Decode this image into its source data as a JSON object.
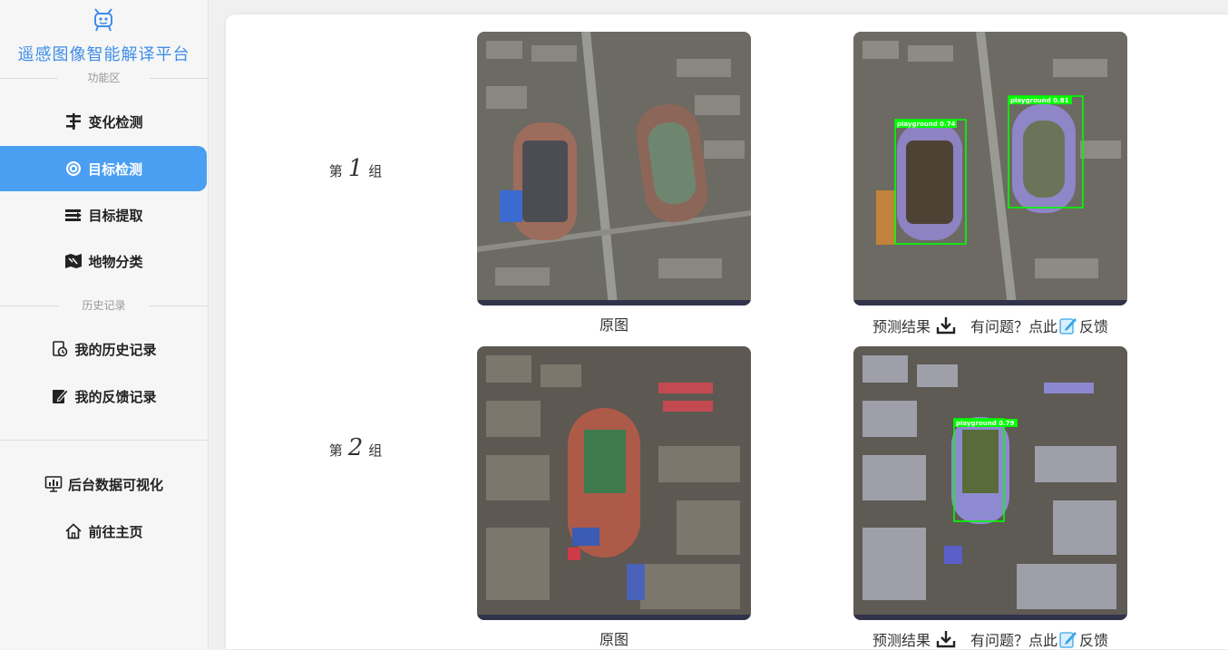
{
  "sidebar": {
    "app_title": "遥感图像智能解译平台",
    "section_functions": "功能区",
    "section_history": "历史记录",
    "items": [
      {
        "label": "变化检测",
        "icon": "change-detect-icon"
      },
      {
        "label": "目标检测",
        "icon": "target-detect-icon",
        "active": true
      },
      {
        "label": "目标提取",
        "icon": "target-extract-icon"
      },
      {
        "label": "地物分类",
        "icon": "land-classify-icon"
      }
    ],
    "history_items": [
      {
        "label": "我的历史记录",
        "icon": "history-icon"
      },
      {
        "label": "我的反馈记录",
        "icon": "feedback-record-icon"
      }
    ],
    "bottom_items": [
      {
        "label": "后台数据可视化",
        "icon": "dashboard-icon"
      },
      {
        "label": "前往主页",
        "icon": "home-icon"
      }
    ]
  },
  "groups": [
    {
      "prefix": "第",
      "number": "1",
      "suffix": "组",
      "original_caption": "原图",
      "result_caption": "预测结果",
      "feedback_prefix": "有问题？点此",
      "feedback_suffix": "反馈",
      "detections": [
        {
          "label": "playground 0.74"
        },
        {
          "label": "playground 0.81"
        }
      ]
    },
    {
      "prefix": "第",
      "number": "2",
      "suffix": "组",
      "original_caption": "原图",
      "result_caption": "预测结果",
      "feedback_prefix": "有问题？点此",
      "feedback_suffix": "反馈",
      "detections": [
        {
          "label": "playground 0.79"
        }
      ]
    }
  ],
  "colors": {
    "accent": "#4b9ff2",
    "title": "#3f8ee8",
    "detection_box": "#00ff00"
  }
}
